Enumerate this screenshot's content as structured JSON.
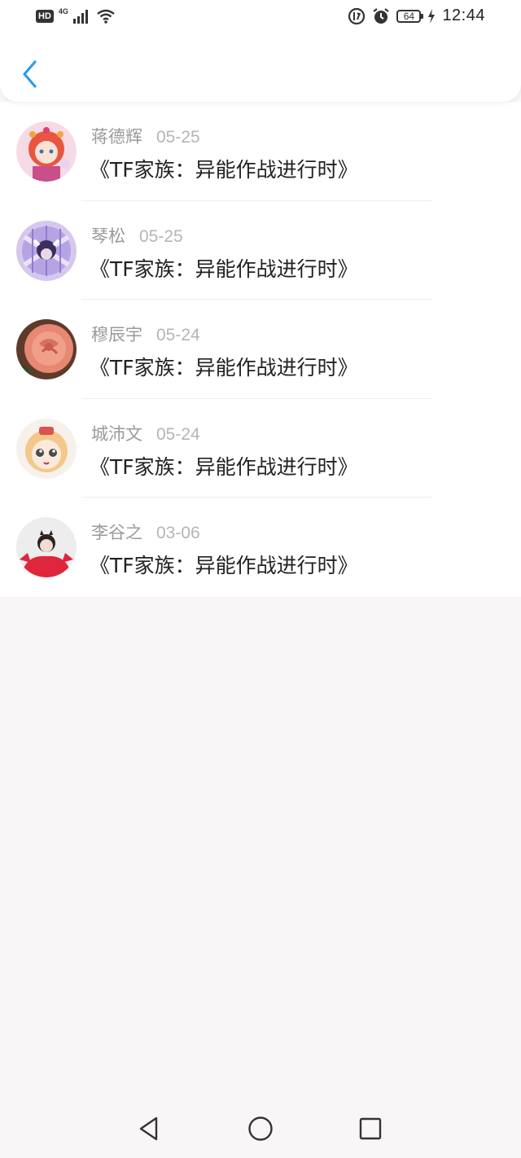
{
  "statusbar": {
    "hd": "HD",
    "network": "4G",
    "battery": "64",
    "time": "12:44",
    "icons": [
      "signal-icon",
      "wifi-icon",
      "data-saver-icon",
      "alarm-icon",
      "charging-icon"
    ]
  },
  "header": {
    "back_icon": "chevron-left-icon",
    "accent_color": "#2d9be8"
  },
  "items": [
    {
      "name": "蒋德辉",
      "date": "05-25",
      "title": "《TF家族：异能作战进行时》",
      "avatar": "anime-girl-red-hair"
    },
    {
      "name": "琴松",
      "date": "05-25",
      "title": "《TF家族：异能作战进行时》",
      "avatar": "purple-plaid-character"
    },
    {
      "name": "穆辰宇",
      "date": "05-24",
      "title": "《TF家族：异能作战进行时》",
      "avatar": "pink-rose"
    },
    {
      "name": "城沛文",
      "date": "05-24",
      "title": "《TF家族：异能作战进行时》",
      "avatar": "cartoon-blonde-face"
    },
    {
      "name": "李谷之",
      "date": "03-06",
      "title": "《TF家族：异能作战进行时》",
      "avatar": "girl-red-sweater"
    }
  ],
  "navbar": {
    "icons": [
      "back-triangle-icon",
      "home-circle-icon",
      "recents-square-icon"
    ]
  }
}
